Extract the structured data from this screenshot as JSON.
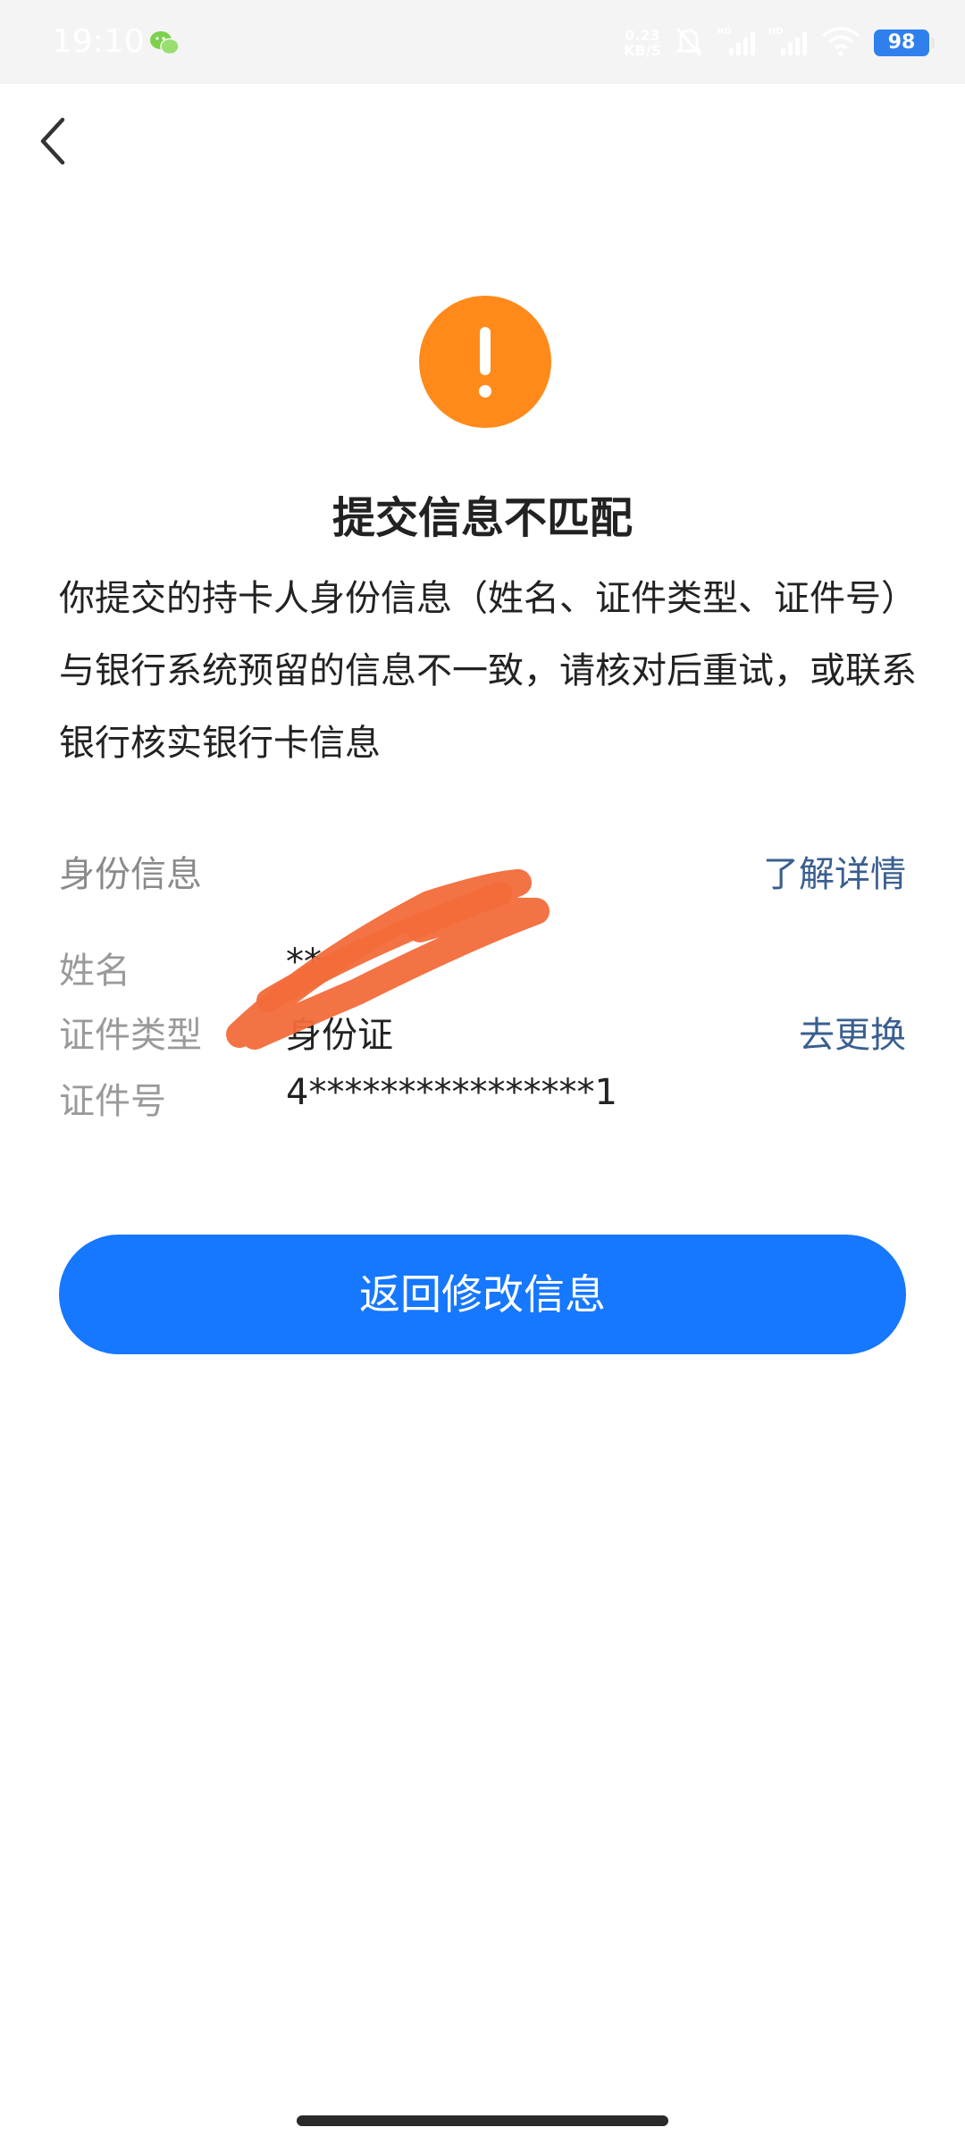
{
  "status_bar": {
    "time": "19:10",
    "net_speed_value": "0.23",
    "net_speed_unit": "KB/S",
    "battery": "98",
    "icons": [
      "wechat-icon",
      "mute-bell-icon",
      "hd-signal-icon",
      "hd-signal-icon",
      "wifi-icon",
      "battery-icon"
    ]
  },
  "nav": {
    "back_icon": "chevron-left-icon"
  },
  "alert": {
    "icon": "exclamation-circle-icon",
    "icon_color": "#FF8A1A",
    "title": "提交信息不匹配",
    "description": "你提交的持卡人身份信息（姓名、证件类型、证件号）与银行系统预留的信息不一致，请核对后重试，或联系银行核实银行卡信息"
  },
  "identity": {
    "section_label": "身份信息",
    "detail_link": "了解详情",
    "rows": [
      {
        "key": "姓名",
        "value": "**"
      },
      {
        "key": "证件类型",
        "value": "身份证",
        "action": "去更换"
      },
      {
        "key": "证件号",
        "value": "4****************1"
      }
    ]
  },
  "actions": {
    "primary_button": "返回修改信息",
    "primary_color": "#1677FF"
  },
  "link_color": "#3A5F8F"
}
